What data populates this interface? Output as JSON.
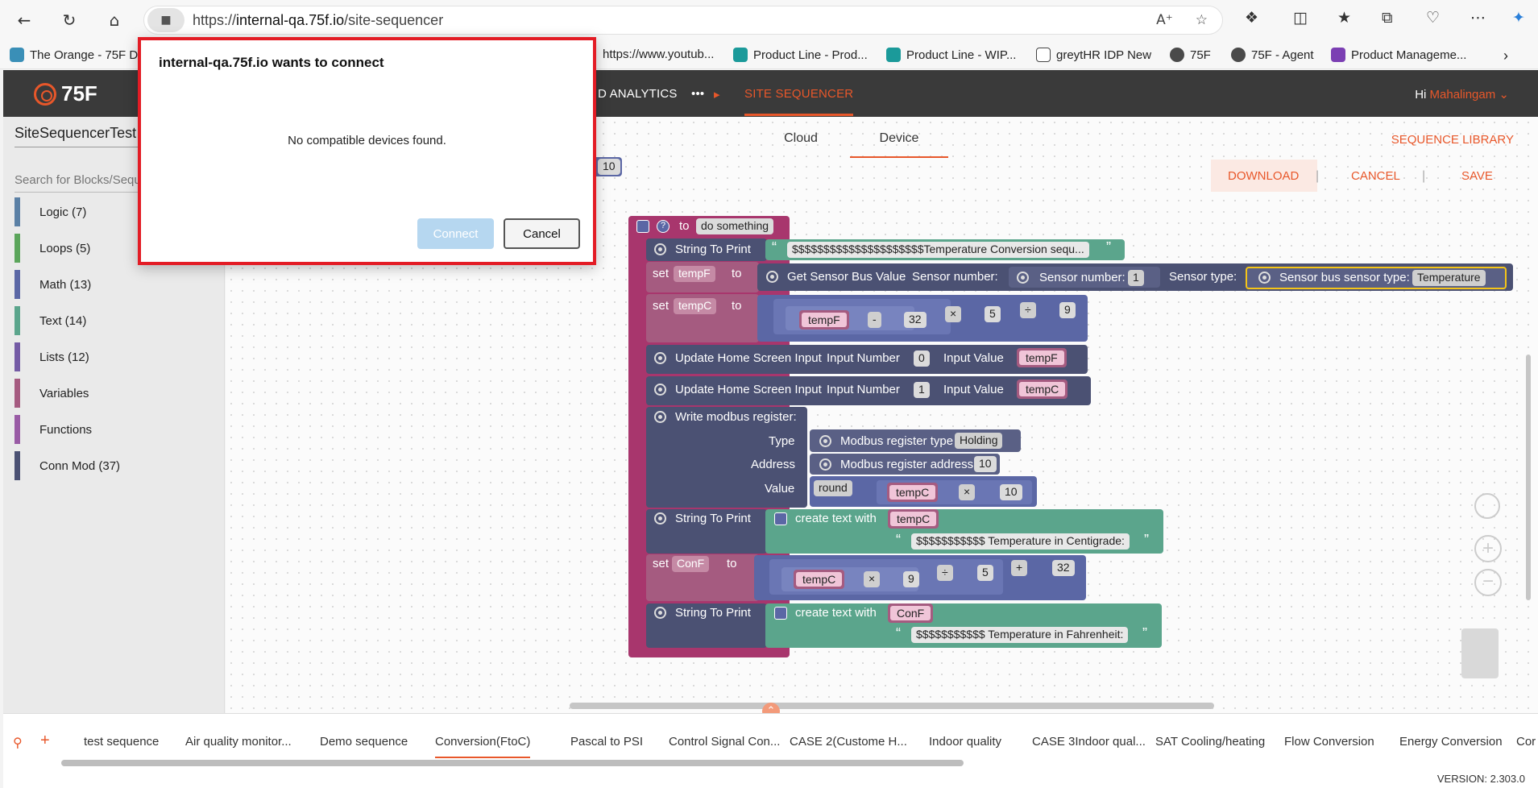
{
  "browser": {
    "url_prefix": "https://",
    "url_host": "internal-qa.75f.io",
    "url_path": "/site-sequencer",
    "bookmarks": [
      {
        "label": "The Orange - 75F D",
        "color": "#3a8fb7"
      },
      {
        "label": "https://www.youtub...",
        "color": "#ffffff"
      },
      {
        "label": "Product Line - Prod...",
        "color": "#1b9a9a"
      },
      {
        "label": "Product Line - WIP...",
        "color": "#1b9a9a"
      },
      {
        "label": "greytHR IDP New",
        "color": "#ffffff"
      },
      {
        "label": "75F",
        "color": "#4a4a4a"
      },
      {
        "label": "75F - Agent",
        "color": "#4a4a4a"
      },
      {
        "label": "Product Manageme...",
        "color": "#7b3fb3"
      }
    ]
  },
  "header": {
    "logo": "75F",
    "nav_partial": "D ANALYTICS",
    "nav_more": "•••",
    "nav_active": "SITE SEQUENCER",
    "greeting": "Hi",
    "user": "Mahalingam"
  },
  "left": {
    "sequence_name": "SiteSequencerTest",
    "search_placeholder": "Search for Blocks/Sequ",
    "categories": [
      {
        "label": "Logic (7)",
        "color": "#5b80a5"
      },
      {
        "label": "Loops (5)",
        "color": "#5ba55b"
      },
      {
        "label": "Math (13)",
        "color": "#5b67a5"
      },
      {
        "label": "Text (14)",
        "color": "#5ba58c"
      },
      {
        "label": "Lists (12)",
        "color": "#745ba5"
      },
      {
        "label": "Variables",
        "color": "#a55b80"
      },
      {
        "label": "Functions",
        "color": "#995ba5"
      },
      {
        "label": "Conn Mod (37)",
        "color": "#4b5173"
      }
    ]
  },
  "toolbar": {
    "tab_cloud": "Cloud",
    "tab_device": "Device",
    "sequence_library": "SEQUENCE LIBRARY",
    "download": "DOWNLOAD",
    "cancel": "CANCEL",
    "save": "SAVE"
  },
  "blocks": {
    "stray_value": "10",
    "function_to": "to",
    "function_name": "do something",
    "string_to_print": "String To Print",
    "str1": "$$$$$$$$$$$$$$$$$$$$$Temperature Conversion sequ...",
    "set": "set",
    "to": "to",
    "var_tempF": "tempF",
    "var_tempC": "tempC",
    "var_ConF": "ConF",
    "get_sensor_bus": "Get Sensor Bus Value",
    "sensor_number_lbl": "Sensor number:",
    "sensor_number_inner": "Sensor number:",
    "sensor_number_val": "1",
    "sensor_type_lbl": "Sensor type:",
    "sensor_bus_type_lbl": "Sensor bus sensor type:",
    "sensor_bus_type_val": "Temperature",
    "op_minus": "-",
    "op_times": "×",
    "op_div": "÷",
    "op_plus": "+",
    "n32": "32",
    "n5": "5",
    "n9": "9",
    "n0": "0",
    "n1": "1",
    "n10": "10",
    "update_home": "Update Home Screen Input",
    "input_number": "Input Number",
    "input_value": "Input Value",
    "write_modbus": "Write modbus register:",
    "type_lbl": "Type",
    "address_lbl": "Address",
    "value_lbl": "Value",
    "modbus_type_lbl": "Modbus register type",
    "modbus_type_val": "Holding",
    "modbus_addr_lbl": "Modbus register address",
    "modbus_addr_val": "10",
    "round": "round",
    "create_text_with": "create text with",
    "str_centigrade": "$$$$$$$$$$$ Temperature in Centigrade:",
    "str_fahrenheit": "$$$$$$$$$$$ Temperature in Fahrenheit:"
  },
  "modal": {
    "title": "internal-qa.75f.io wants to connect",
    "message": "No compatible devices found.",
    "connect": "Connect",
    "cancel": "Cancel"
  },
  "bottom": {
    "tabs": [
      "test sequence",
      "Air quality monitor...",
      "Demo sequence",
      "Conversion(FtoC)",
      "Pascal to PSI",
      "Control Signal Con...",
      "CASE 2(Custome H...",
      "Indoor quality",
      "CASE 3Indoor qual...",
      "SAT Cooling/heating",
      "Flow Conversion",
      "Energy Conversion",
      "Cor"
    ],
    "active_tab": "Conversion(FtoC)",
    "version": "VERSION: 2.303.0"
  }
}
